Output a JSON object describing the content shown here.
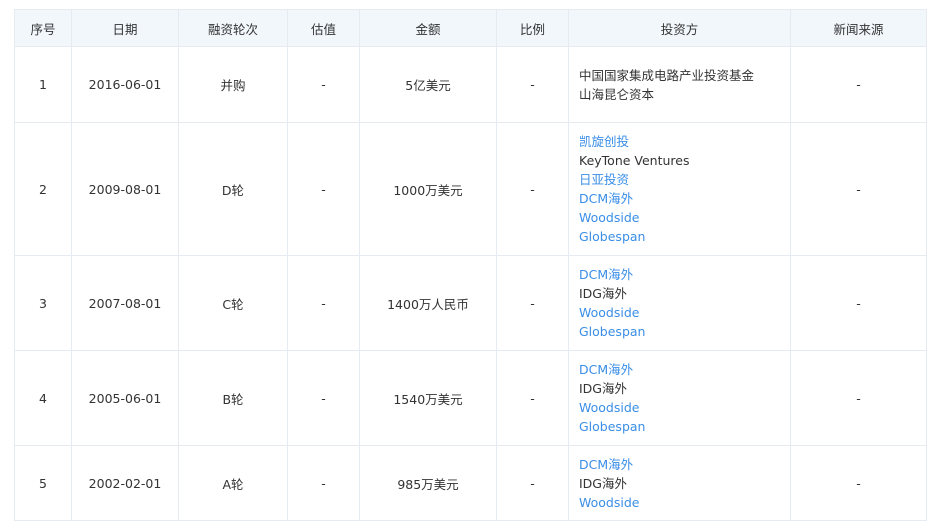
{
  "table": {
    "headers": [
      "序号",
      "日期",
      "融资轮次",
      "估值",
      "金额",
      "比例",
      "投资方",
      "新闻来源"
    ],
    "rows": [
      {
        "index": "1",
        "date": "2016-06-01",
        "round": "并购",
        "valuation": "-",
        "amount": "5亿美元",
        "ratio": "-",
        "investors": [
          {
            "name": "中国国家集成电路产业投资基金",
            "link": false
          },
          {
            "name": "山海昆仑资本",
            "link": false
          }
        ],
        "news": "-"
      },
      {
        "index": "2",
        "date": "2009-08-01",
        "round": "D轮",
        "valuation": "-",
        "amount": "1000万美元",
        "ratio": "-",
        "investors": [
          {
            "name": "凯旋创投",
            "link": true
          },
          {
            "name": "KeyTone Ventures",
            "link": false
          },
          {
            "name": "日亚投资",
            "link": true
          },
          {
            "name": "DCM海外",
            "link": true
          },
          {
            "name": "Woodside",
            "link": true
          },
          {
            "name": "Globespan",
            "link": true
          }
        ],
        "news": "-"
      },
      {
        "index": "3",
        "date": "2007-08-01",
        "round": "C轮",
        "valuation": "-",
        "amount": "1400万人民币",
        "ratio": "-",
        "investors": [
          {
            "name": "DCM海外",
            "link": true
          },
          {
            "name": "IDG海外",
            "link": false
          },
          {
            "name": "Woodside",
            "link": true
          },
          {
            "name": "Globespan",
            "link": true
          }
        ],
        "news": "-"
      },
      {
        "index": "4",
        "date": "2005-06-01",
        "round": "B轮",
        "valuation": "-",
        "amount": "1540万美元",
        "ratio": "-",
        "investors": [
          {
            "name": "DCM海外",
            "link": true
          },
          {
            "name": "IDG海外",
            "link": false
          },
          {
            "name": "Woodside",
            "link": true
          },
          {
            "name": "Globespan",
            "link": true
          }
        ],
        "news": "-"
      },
      {
        "index": "5",
        "date": "2002-02-01",
        "round": "A轮",
        "valuation": "-",
        "amount": "985万美元",
        "ratio": "-",
        "investors": [
          {
            "name": "DCM海外",
            "link": true
          },
          {
            "name": "IDG海外",
            "link": false
          },
          {
            "name": "Woodside",
            "link": true
          }
        ],
        "news": "-"
      }
    ]
  },
  "colors": {
    "header_bg": "#f2f7fc",
    "border": "#e6ebf1",
    "link": "#3a8ee6",
    "text": "#333333"
  }
}
